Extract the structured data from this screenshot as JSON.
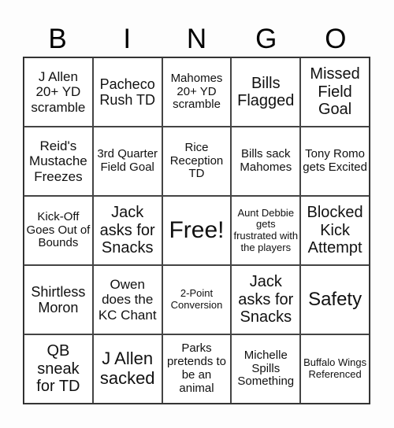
{
  "header": [
    "B",
    "I",
    "N",
    "G",
    "O"
  ],
  "cells": [
    "J Allen 20+ YD scramble",
    "Pacheco Rush TD",
    "Mahomes 20+ YD scramble",
    "Bills Flagged",
    "Missed Field Goal",
    "Reid's Mustache Freezes",
    "3rd Quarter Field Goal",
    "Rice Reception TD",
    "Bills sack Mahomes",
    "Tony Romo gets Excited",
    "Kick-Off Goes Out of Bounds",
    "Jack asks for Snacks",
    "Free!",
    "Aunt Debbie gets frustrated with the players",
    "Blocked Kick Attempt",
    "Shirtless Moron",
    "Owen does the KC Chant",
    "2-Point Conversion",
    "Jack asks for Snacks",
    "Safety",
    "QB sneak for TD",
    "J Allen sacked",
    "Parks pretends to be an animal",
    "Michelle Spills Something",
    "Buffalo Wings Referenced"
  ]
}
